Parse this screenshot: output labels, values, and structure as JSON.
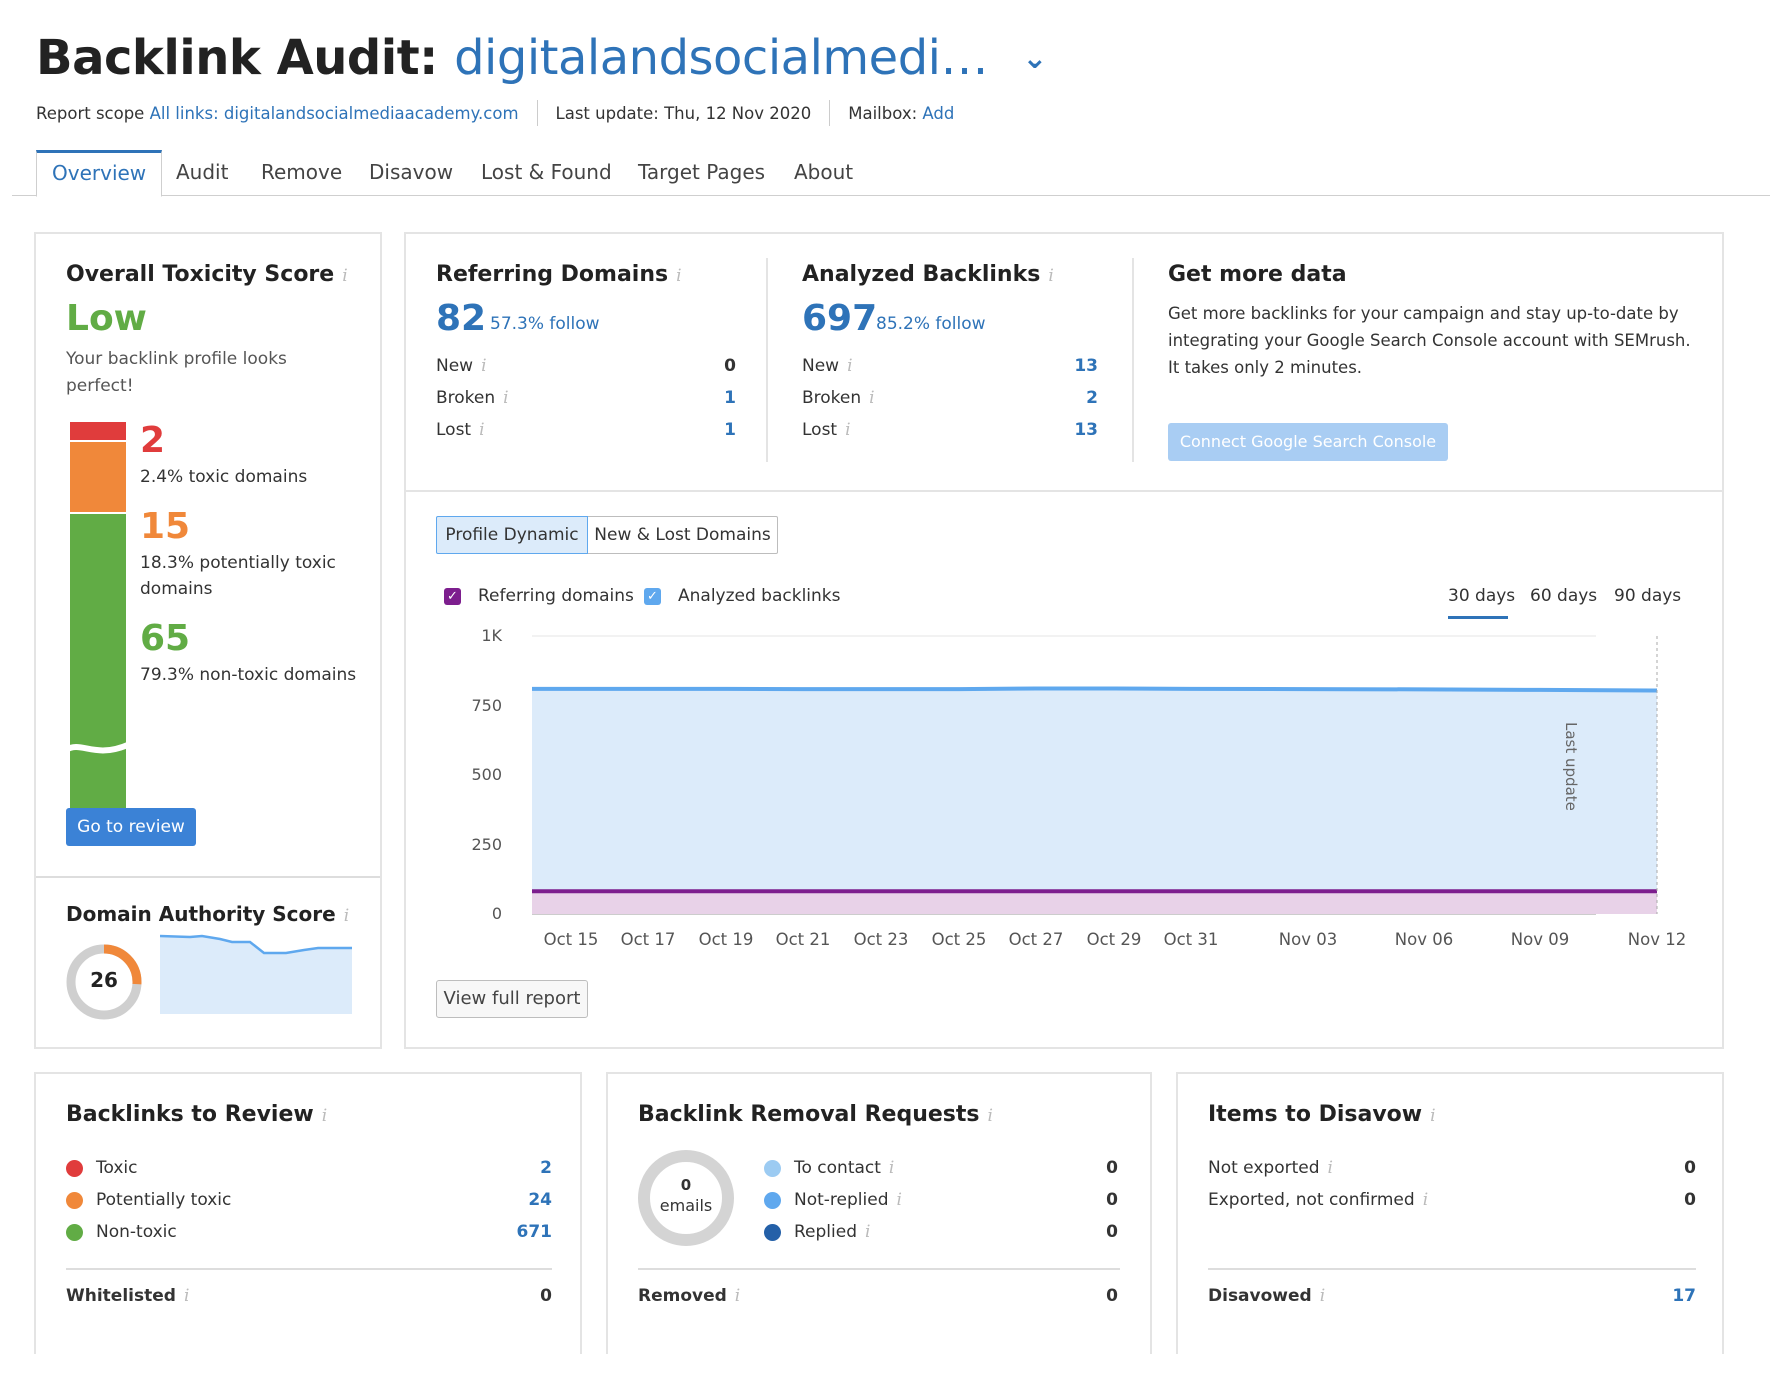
{
  "header": {
    "title_prefix": "Backlink Audit:",
    "title_domain": "digitalandsocialmedi…",
    "report_scope_label": "Report scope",
    "report_scope_value": "All links: digitalandsocialmediaacademy.com",
    "last_update": "Last update: Thu, 12 Nov 2020",
    "mailbox_label": "Mailbox:",
    "mailbox_action": "Add"
  },
  "tabs": [
    "Overview",
    "Audit",
    "Remove",
    "Disavow",
    "Lost & Found",
    "Target Pages",
    "About"
  ],
  "toxicity": {
    "title": "Overall Toxicity Score",
    "level": "Low",
    "description": "Your backlink profile looks perfect!",
    "toxic_count": "2",
    "toxic_desc": "2.4% toxic domains",
    "potential_count": "15",
    "potential_desc": "18.3% potentially toxic domains",
    "nontoxic_count": "65",
    "nontoxic_desc": "79.3% non-toxic domains",
    "button": "Go to review",
    "colors": {
      "toxic": "#E03C3C",
      "potential": "#F0883A",
      "nontoxic": "#61AC45"
    }
  },
  "authority": {
    "title": "Domain Authority Score",
    "score": "26",
    "score_value": 26
  },
  "referring_domains": {
    "title": "Referring Domains",
    "value": "82",
    "follow": "57.3% follow",
    "rows": [
      {
        "label": "New",
        "value": "0"
      },
      {
        "label": "Broken",
        "value": "1"
      },
      {
        "label": "Lost",
        "value": "1"
      }
    ]
  },
  "analyzed_backlinks": {
    "title": "Analyzed Backlinks",
    "value": "697",
    "follow": "85.2% follow",
    "rows": [
      {
        "label": "New",
        "value": "13"
      },
      {
        "label": "Broken",
        "value": "2"
      },
      {
        "label": "Lost",
        "value": "13"
      }
    ]
  },
  "get_more": {
    "title": "Get more data",
    "text": "Get more backlinks for your campaign and stay up-to-date by integrating your Google Search Console account with SEMrush. It takes only 2 minutes.",
    "button": "Connect Google Search Console"
  },
  "chart_tabs": [
    "Profile Dynamic",
    "New & Lost Domains"
  ],
  "legend": {
    "referring": "Referring domains",
    "analyzed": "Analyzed backlinks"
  },
  "ranges": [
    "30 days",
    "60 days",
    "90 days"
  ],
  "last_update_marker": "Last update",
  "view_full_report": "View full report",
  "chart_data": {
    "type": "area",
    "x": [
      "Oct 15",
      "Oct 17",
      "Oct 19",
      "Oct 21",
      "Oct 23",
      "Oct 25",
      "Oct 27",
      "Oct 29",
      "Oct 31",
      "Nov 03",
      "Nov 06",
      "Nov 09",
      "Nov 12"
    ],
    "series": [
      {
        "name": "Analyzed backlinks",
        "color": "#5FA8EE",
        "values": [
          810,
          810,
          810,
          809,
          809,
          809,
          811,
          811,
          810,
          809,
          808,
          806,
          804
        ]
      },
      {
        "name": "Referring domains",
        "color": "#7D1E8E",
        "values": [
          82,
          82,
          82,
          82,
          82,
          82,
          82,
          82,
          82,
          82,
          82,
          82,
          82
        ]
      }
    ],
    "yticks": [
      "1K",
      "750",
      "500",
      "250",
      "0"
    ],
    "ylim": [
      0,
      1000
    ],
    "grid": true
  },
  "review": {
    "title": "Backlinks to Review",
    "rows": [
      {
        "label": "Toxic",
        "value": "2",
        "color": "#E03C3C"
      },
      {
        "label": "Potentially toxic",
        "value": "24",
        "color": "#F0883A"
      },
      {
        "label": "Non-toxic",
        "value": "671",
        "color": "#61AC45"
      }
    ],
    "footer_label": "Whitelisted",
    "footer_value": "0"
  },
  "removal": {
    "title": "Backlink Removal Requests",
    "emails_count": "0",
    "emails_label": "emails",
    "rows": [
      {
        "label": "To contact",
        "value": "0",
        "color": "#9CCBF2"
      },
      {
        "label": "Not-replied",
        "value": "0",
        "color": "#5FA8EE"
      },
      {
        "label": "Replied",
        "value": "0",
        "color": "#2460A8"
      }
    ],
    "footer_label": "Removed",
    "footer_value": "0"
  },
  "disavow": {
    "title": "Items to Disavow",
    "rows": [
      {
        "label": "Not exported",
        "value": "0"
      },
      {
        "label": "Exported, not confirmed",
        "value": "0"
      }
    ],
    "footer_label": "Disavowed",
    "footer_value": "17"
  }
}
